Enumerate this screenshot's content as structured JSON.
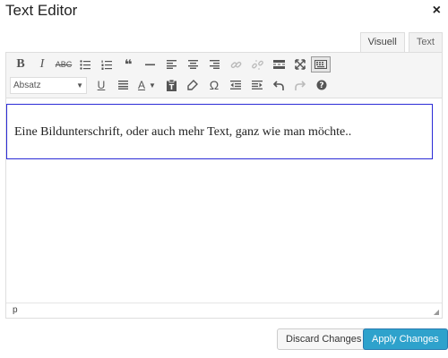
{
  "dialog": {
    "title": "Text Editor",
    "close_symbol": "×"
  },
  "tabs": [
    {
      "label": "Visuell",
      "active": true
    },
    {
      "label": "Text",
      "active": false
    }
  ],
  "toolbar": {
    "row1": [
      "bold-icon",
      "italic-icon",
      "strikethrough-icon",
      "bullet-list-icon",
      "numbered-list-icon",
      "blockquote-icon",
      "horizontal-line-icon",
      "align-left-icon",
      "align-center-icon",
      "align-right-icon",
      "link-icon",
      "unlink-icon",
      "read-more-icon",
      "fullscreen-icon",
      "keyboard-icon"
    ],
    "row2": [
      "format-select",
      "underline-icon",
      "justify-icon",
      "text-color-icon",
      "paste-text-icon",
      "clear-formatting-icon",
      "special-character-icon",
      "outdent-icon",
      "indent-icon",
      "undo-icon",
      "redo-icon",
      "help-icon"
    ],
    "format_value": "Absatz",
    "bold_label": "B",
    "italic_label": "I",
    "strike_label": "ABC",
    "underline_label": "U",
    "textcolor_label": "A",
    "omega_label": "Ω",
    "quote_label": "❝"
  },
  "editor": {
    "content_text": "Eine Bildunterschrift, oder auch mehr Text, ganz wie man möchte..",
    "status_path": "p"
  },
  "buttons": {
    "discard_label": "Discard Changes",
    "apply_label": "Apply Changes"
  },
  "colors": {
    "apply_bg": "#2ea2cc",
    "focus_border": "#2b2bd6"
  }
}
